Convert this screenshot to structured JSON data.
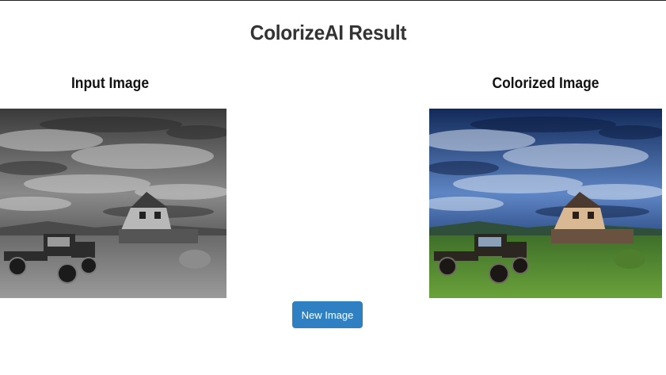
{
  "page": {
    "title": "ColorizeAI Result"
  },
  "input_panel": {
    "title": "Input Image"
  },
  "output_panel": {
    "title": "Colorized Image"
  },
  "actions": {
    "new_image_label": "New Image"
  },
  "colors": {
    "button_background": "#2f80c3",
    "button_text": "#ffffff",
    "title_text": "#333333"
  }
}
